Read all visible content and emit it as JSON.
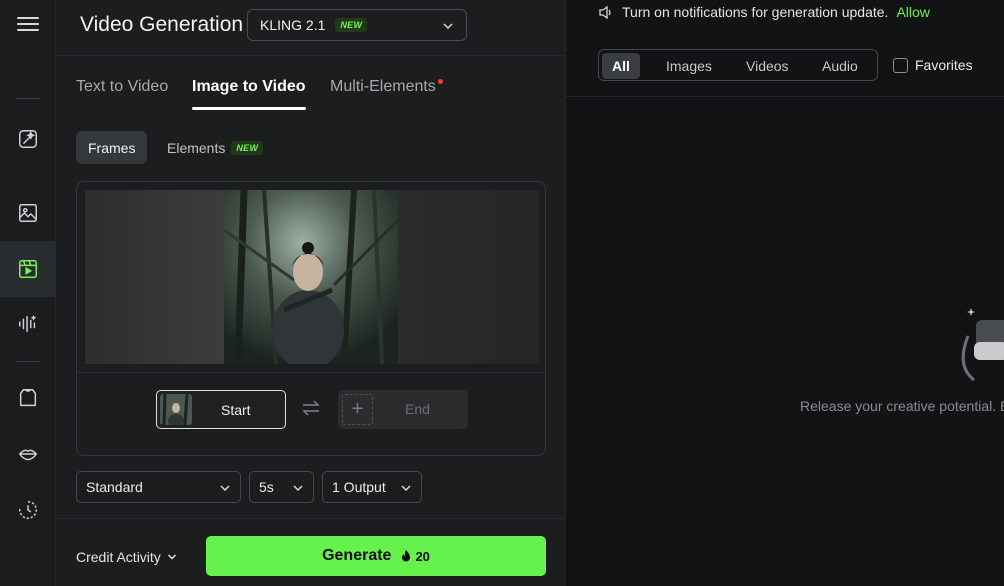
{
  "rail": {
    "items": [
      {
        "icon": "magic-wand-icon"
      },
      {
        "icon": "image-icon"
      },
      {
        "icon": "video-icon",
        "active": true
      },
      {
        "icon": "audio-wave-icon"
      },
      {
        "icon": "shirt-icon"
      },
      {
        "icon": "lips-icon"
      },
      {
        "icon": "history-icon"
      }
    ]
  },
  "header": {
    "title": "Video Generation",
    "model": "KLING 2.1",
    "model_badge": "NEW"
  },
  "tabs": [
    "Text to Video",
    "Image to Video",
    "Multi-Elements"
  ],
  "subtabs": {
    "frames": "Frames",
    "elements": "Elements",
    "elements_badge": "NEW"
  },
  "frames": {
    "start_label": "Start",
    "end_label": "End"
  },
  "options": {
    "mode": "Standard",
    "duration": "5s",
    "outputs": "1 Output"
  },
  "footer": {
    "credit_label": "Credit Activity",
    "generate_label": "Generate",
    "generate_cost": "20"
  },
  "notification": {
    "text": "Turn on notifications for generation update.",
    "action": "Allow"
  },
  "filters": [
    "All",
    "Images",
    "Videos",
    "Audio"
  ],
  "favorites_label": "Favorites",
  "empty_state": "Release your creative potential. E",
  "colors": {
    "accent": "#66f24d",
    "active_rail_icon": "#7cf05a"
  }
}
